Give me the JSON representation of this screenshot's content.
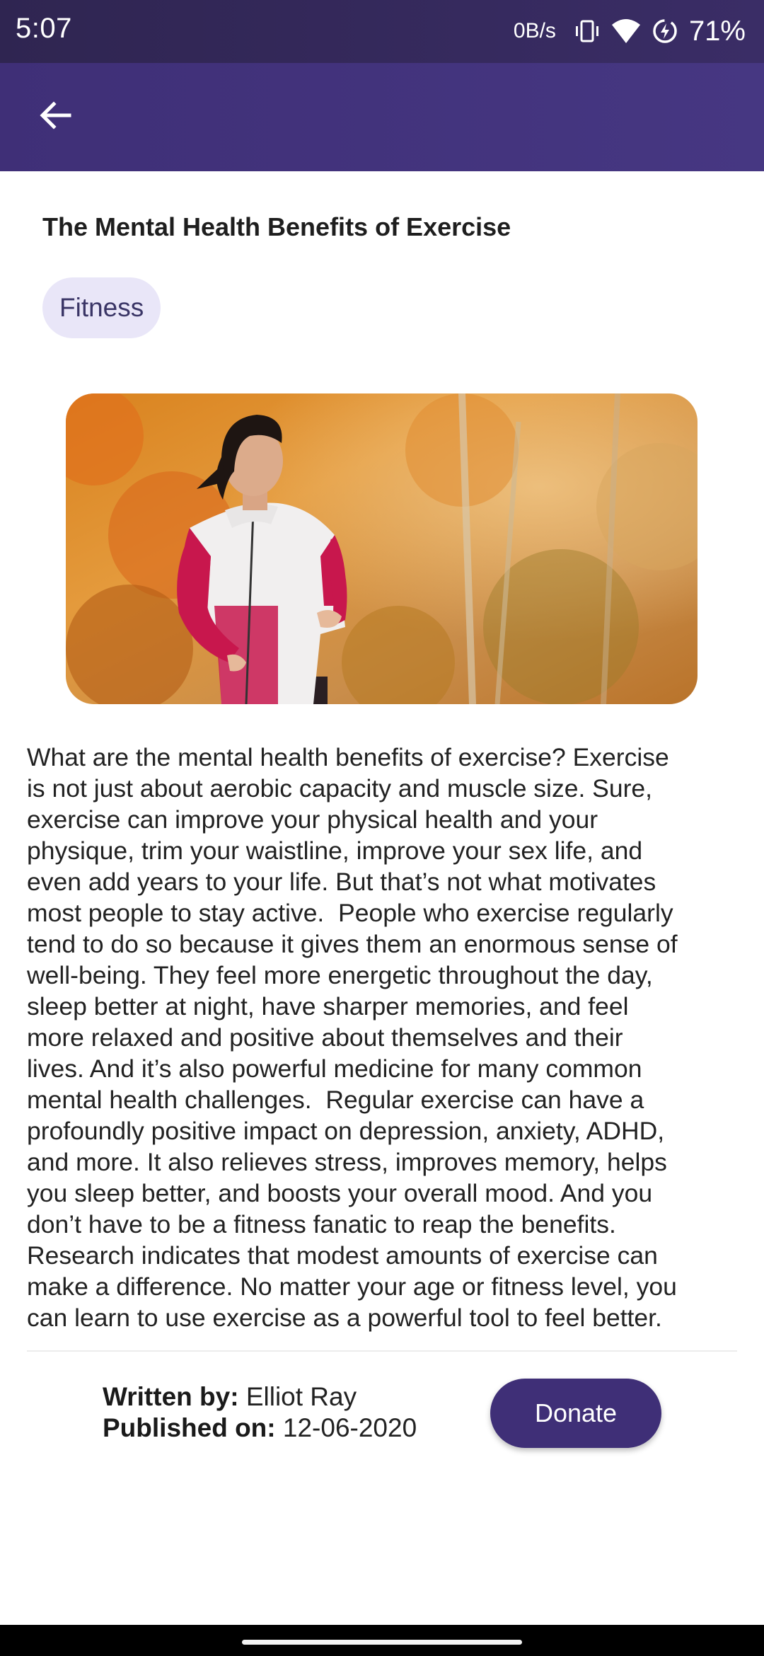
{
  "status_bar": {
    "time": "5:07",
    "net_speed": "0B/s",
    "battery": "71%",
    "icons": [
      "vibrate-icon",
      "wifi-icon",
      "battery-saver-icon"
    ]
  },
  "app_bar": {
    "back_icon": "arrow-left-icon",
    "color": "#433380"
  },
  "article": {
    "title": "The Mental Health Benefits of Exercise",
    "category": "Fitness",
    "image_icon": "woman-jogging-autumn-photo",
    "body": "What are the mental health benefits of exercise? Exercise\nis not just about aerobic capacity and muscle size. Sure,\nexercise can improve your physical health and your\nphysique, trim your waistline, improve your sex life, and\neven add years to your life. But that’s not what motivates\nmost people to stay active.  People who exercise regularly\ntend to do so because it gives them an enormous sense of\nwell-being. They feel more energetic throughout the day,\nsleep better at night, have sharper memories, and feel\nmore relaxed and positive about themselves and their\nlives. And it’s also powerful medicine for many common\nmental health challenges.  Regular exercise can have a\nprofoundly positive impact on depression, anxiety, ADHD,\nand more. It also relieves stress, improves memory, helps\nyou sleep better, and boosts your overall mood. And you\ndon’t have to be a fitness fanatic to reap the benefits.\nResearch indicates that modest amounts of exercise can\nmake a difference. No matter your age or fitness level, you\ncan learn to use exercise as a powerful tool to feel better."
  },
  "meta": {
    "written_by_label": "Written by:",
    "author": "Elliot Ray",
    "published_on_label": "Published on:",
    "published_date": "12-06-2020"
  },
  "actions": {
    "donate_label": "Donate"
  },
  "colors": {
    "primary": "#3f2f77",
    "chip_bg": "#e9e6f8",
    "chip_text": "#3a3566"
  }
}
